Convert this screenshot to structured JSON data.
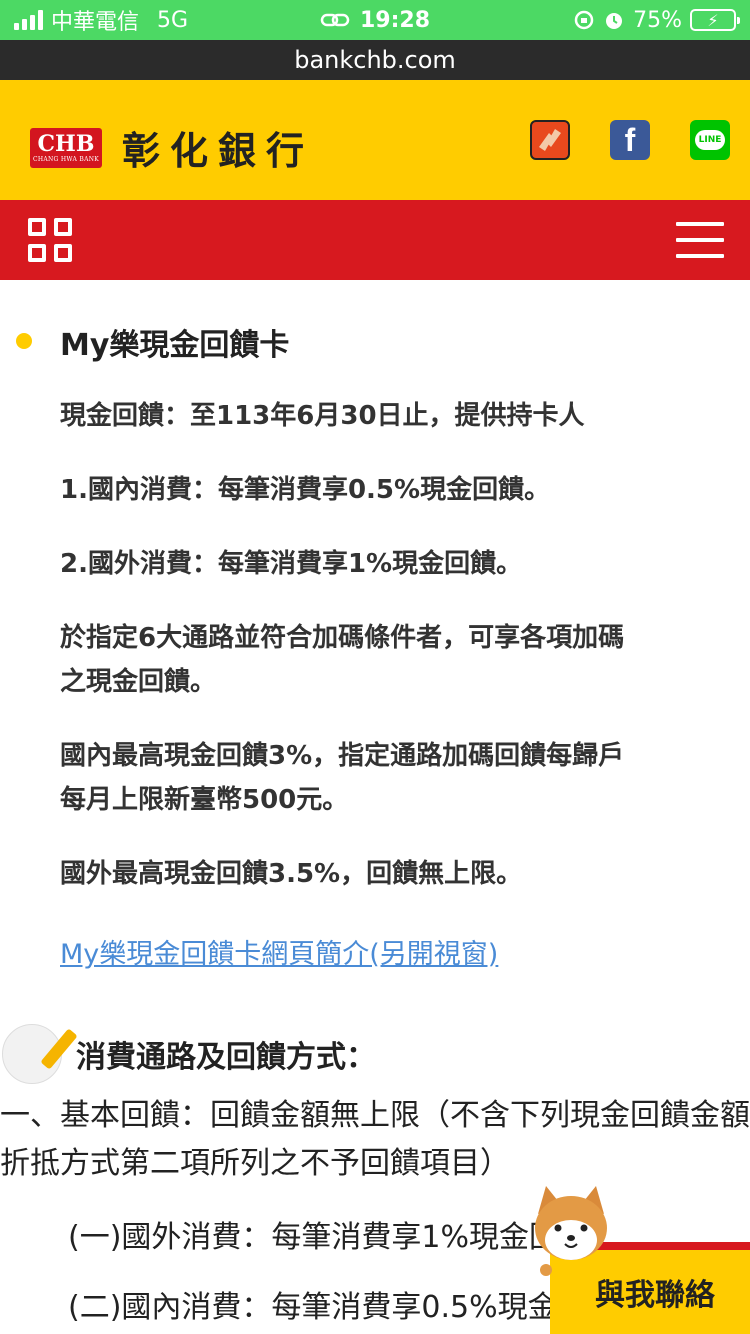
{
  "status_bar": {
    "carrier": "中華電信",
    "network": "5G",
    "time": "19:28",
    "battery": "75%"
  },
  "url_bar": {
    "url": "bankchb.com"
  },
  "header": {
    "logo_mark": "CHB",
    "logo_sub": "CHANG HWA BANK",
    "bank_name": "彰化銀行",
    "social_icons": [
      "hand-icon",
      "facebook-icon",
      "line-icon"
    ],
    "line_text": "LINE"
  },
  "colors": {
    "brand_yellow": "#ffcc00",
    "brand_red": "#d7191f",
    "status_green": "#4cd964",
    "link_blue": "#4a8bd6"
  },
  "card": {
    "title": "My樂現金回饋卡",
    "p1": "現金回饋：至113年6月30日止，提供持卡人",
    "p2": "1.國內消費：每筆消費享0.5%現金回饋。",
    "p3": "2.國外消費：每筆消費享1%現金回饋。",
    "p4": "於指定6大通路並符合加碼條件者，可享各項加碼之現金回饋。",
    "p5": "國內最高現金回饋3%，指定通路加碼回饋每歸戶每月上限新臺幣500元。",
    "p6": "國外最高現金回饋3.5%，回饋無上限。",
    "link": "My樂現金回饋卡網頁簡介(另開視窗)"
  },
  "section": {
    "title": "消費通路及回饋方式：",
    "body": "一、基本回饋：回饋金額無上限（不含下列現金回饋金額折抵方式第二項所列之不予回饋項目）",
    "item1": "(一)國外消費：每筆消費享1%現金回饋。",
    "item2": "(二)國內消費：每筆消費享0.5%現金回饋。"
  },
  "contact": {
    "label": "與我聯絡"
  }
}
